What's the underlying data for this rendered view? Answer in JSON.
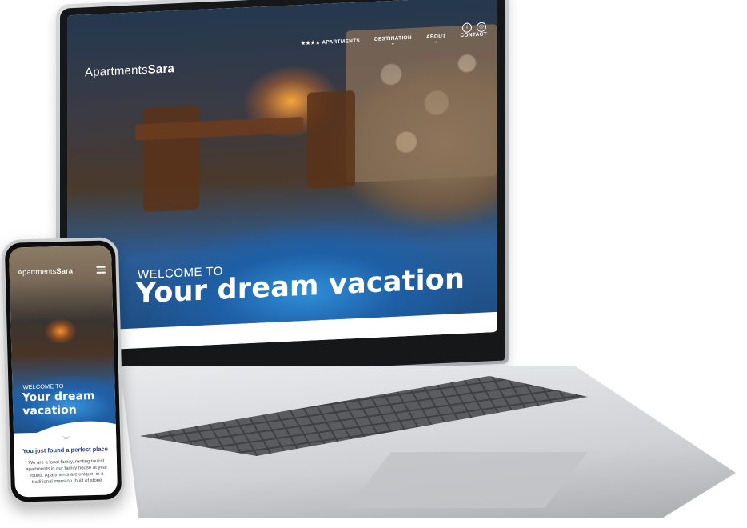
{
  "desktop": {
    "logo": {
      "text_regular": "Apartments",
      "text_bold": "Sara"
    },
    "nav": [
      {
        "label": "★★★★ APARTMENTS",
        "has_dropdown": false
      },
      {
        "label": "DESTINATION",
        "has_dropdown": true
      },
      {
        "label": "ABOUT",
        "has_dropdown": true
      },
      {
        "label": "CONTACT",
        "has_dropdown": false
      }
    ],
    "social": {
      "facebook_icon": "f",
      "instagram_icon": "◎"
    },
    "hero": {
      "kicker": "WELCOME TO",
      "headline": "Your dream vacation",
      "scroll_icon": "︾"
    }
  },
  "mobile": {
    "logo": {
      "text_regular": "Apartments",
      "text_bold": "Sara"
    },
    "hero": {
      "kicker": "WELCOME TO",
      "headline": "Your dream vacation",
      "scroll_icon": "︾"
    },
    "section": {
      "title": "You just found a perfect place",
      "body": "We are a local family, renting tourist apartments in our family house at year round. Apartments are unique, in a traditional mansion, built of stone"
    }
  },
  "colors": {
    "accent_blue": "#1f3f8f",
    "pool_blue": "#2b5d97",
    "laptop_silver": "#cfd1d4"
  }
}
